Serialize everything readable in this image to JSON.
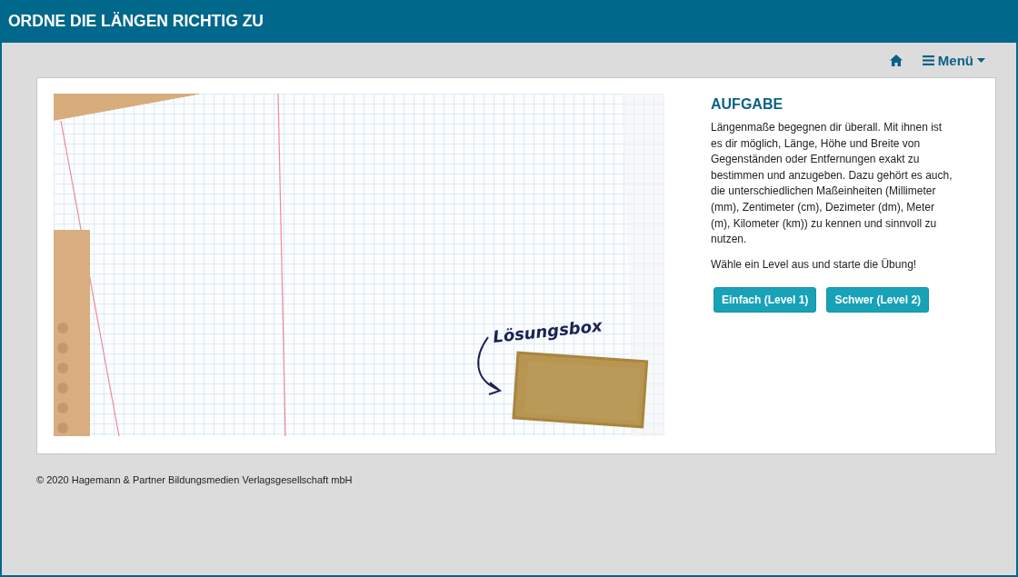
{
  "header": {
    "title": "ORDNE DIE LÄNGEN RICHTIG ZU"
  },
  "nav": {
    "menu_label": "Menü"
  },
  "illustration": {
    "label": "Lösungsbox"
  },
  "task": {
    "heading": "AUFGABE",
    "paragraphs": [
      "Längenmaße begegnen dir überall. Mit ihnen ist es dir möglich, Länge, Höhe und Breite von Gegenständen oder Entfernungen exakt zu bestimmen und anzugeben. Dazu gehört es auch, die unterschiedlichen Maßeinheiten (Millimeter (mm), Zentimeter (cm), Dezimeter (dm), Meter (m), Kilometer (km)) zu kennen und sinnvoll zu nutzen.",
      "Wähle ein Level aus und starte die Übung!"
    ],
    "buttons": [
      "Einfach (Level 1)",
      "Schwer (Level 2)"
    ]
  },
  "footer": {
    "copyright": "© 2020 Hagemann & Partner Bildungsmedien Verlagsgesellschaft mbH"
  }
}
